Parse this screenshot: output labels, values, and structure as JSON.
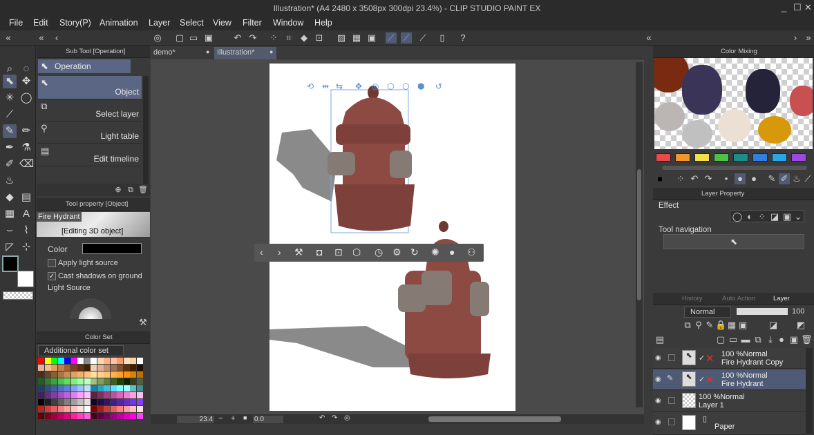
{
  "window": {
    "title": "Illustration* (A4 2480 x 3508px 300dpi 23.4%) - CLIP STUDIO PAINT EX",
    "minimize": "_",
    "maximize": "☐",
    "close": "✕"
  },
  "menu": [
    "File",
    "Edit",
    "Story(P)",
    "Animation",
    "Layer",
    "Select",
    "View",
    "Filter",
    "Window",
    "Help"
  ],
  "subtool": {
    "header": "Sub Tool [Operation]",
    "group": "Operation",
    "items": [
      "Object",
      "Select layer",
      "Light table",
      "Edit timeline"
    ]
  },
  "toolprop": {
    "header": "Tool property [Object]",
    "object_name": "Fire Hydrant",
    "editing": "[Editing 3D object]",
    "color_label": "Color",
    "apply_light": "Apply light source",
    "cast_shadows": "Cast shadows on ground",
    "light_source": "Light Source"
  },
  "colorset": {
    "header": "Color Set",
    "selector": "Additional color set"
  },
  "document_tabs": [
    "demo*",
    "Illustration*"
  ],
  "status": {
    "zoom": "23.4",
    "rotation": "0.0"
  },
  "color_mixing": {
    "header": "Color Mixing"
  },
  "layer_property": {
    "header": "Layer Property",
    "effect": "Effect",
    "tool_nav": "Tool navigation"
  },
  "layer_panel": {
    "tabs": [
      "History",
      "Auto Action",
      "Layer"
    ],
    "blend": "Normal",
    "opacity": "100",
    "layers": [
      {
        "mode": "100 %Normal",
        "name": "Fire Hydrant Copy",
        "selected": false
      },
      {
        "mode": "100 %Normal",
        "name": "Fire Hydrant",
        "selected": true
      },
      {
        "mode": "100 %Normal",
        "name": "Layer 1",
        "selected": false
      },
      {
        "mode": "",
        "name": "Paper",
        "selected": false
      }
    ]
  },
  "palette_colors": [
    "#e84a4a",
    "#f0962e",
    "#f2e04a",
    "#4cc04a",
    "#1e8c8a",
    "#2f7fe0",
    "#2aa6e6",
    "#9b4ae0"
  ],
  "colors": {
    "accent": "#5a6684",
    "canvas_bg": "#4a4a4a",
    "hydrant": "#8d4a43"
  }
}
